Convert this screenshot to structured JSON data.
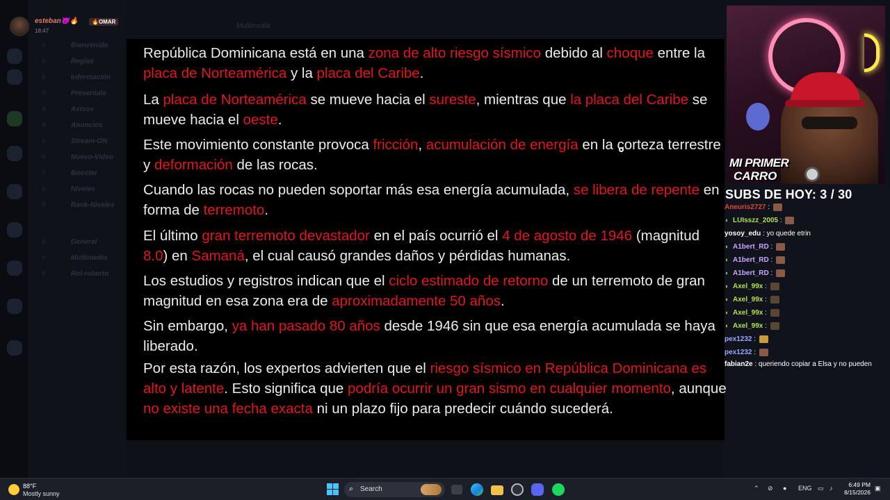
{
  "stream": {
    "streamer_name": "esteban👿🔥",
    "streamer_time": "18:47",
    "streamer_badge": "🔥OMAR",
    "bg_channel_title": "Multimedia",
    "bg_channels": [
      "Bienvenida",
      "Reglas",
      "Información",
      "Presentate",
      "Avisos",
      "Anuncios",
      "Stream-ON",
      "Nuevo-Video",
      "Booster",
      "Niveles",
      "Rank-Niveles",
      "General",
      "Multimedia",
      "Rol-roberto"
    ]
  },
  "article": {
    "paragraphs": [
      [
        {
          "t": "República Dominicana está en una ",
          "red": false
        },
        {
          "t": "zona de alto riesgo sísmico",
          "red": true
        },
        {
          "t": " debido al ",
          "red": false
        },
        {
          "t": "choque",
          "red": true
        },
        {
          "t": " entre la ",
          "red": false
        },
        {
          "t": "placa de Norteamérica",
          "red": true
        },
        {
          "t": " y la ",
          "red": false
        },
        {
          "t": "placa del Caribe",
          "red": true
        },
        {
          "t": ".",
          "red": false
        }
      ],
      [
        {
          "t": "La ",
          "red": false
        },
        {
          "t": "placa de Norteamérica",
          "red": true
        },
        {
          "t": " se mueve hacia el ",
          "red": false
        },
        {
          "t": "sureste",
          "red": true
        },
        {
          "t": ", mientras que ",
          "red": false
        },
        {
          "t": "la placa del Caribe",
          "red": true
        },
        {
          "t": " se mueve hacia el ",
          "red": false
        },
        {
          "t": "oeste",
          "red": true
        },
        {
          "t": ".",
          "red": false
        }
      ],
      [
        {
          "t": "Este movimiento constante provoca ",
          "red": false
        },
        {
          "t": "fricción",
          "red": true
        },
        {
          "t": ", ",
          "red": false
        },
        {
          "t": "acumulación de energía",
          "red": true
        },
        {
          "t": " en la corteza terrestre y ",
          "red": false
        },
        {
          "t": "deformación",
          "red": true
        },
        {
          "t": " de las rocas.",
          "red": false
        }
      ],
      [
        {
          "t": "Cuando las rocas no pueden soportar más esa energía acumulada, ",
          "red": false
        },
        {
          "t": "se libera de repente",
          "red": true
        },
        {
          "t": " en forma de ",
          "red": false
        },
        {
          "t": "terremoto",
          "red": true
        },
        {
          "t": ".",
          "red": false
        }
      ],
      [
        {
          "t": "El último ",
          "red": false
        },
        {
          "t": "gran terremoto devastador",
          "red": true
        },
        {
          "t": " en el país ocurrió el ",
          "red": false
        },
        {
          "t": "4 de agosto de 1946",
          "red": true
        },
        {
          "t": " (magnitud ",
          "red": false
        },
        {
          "t": "8.0",
          "red": true
        },
        {
          "t": ") en ",
          "red": false
        },
        {
          "t": "Samaná",
          "red": true
        },
        {
          "t": ", el cual causó grandes daños y pérdidas humanas.",
          "red": false
        }
      ],
      [
        {
          "t": "Los estudios y registros indican que el ",
          "red": false
        },
        {
          "t": "ciclo estimado de retorno",
          "red": true
        },
        {
          "t": " de un terremoto de gran magnitud en esa zona era de ",
          "red": false
        },
        {
          "t": "aproximadamente 50 años",
          "red": true
        },
        {
          "t": ".",
          "red": false
        }
      ],
      [
        {
          "t": "Sin embargo, ",
          "red": false
        },
        {
          "t": "ya han pasado 80 años",
          "red": true
        },
        {
          "t": " desde 1946 sin que esa energía acumulada se haya liberado.",
          "red": false
        }
      ],
      [
        {
          "t": "Por esta razón, los expertos advierten que el ",
          "red": false
        },
        {
          "t": "riesgo sísmico en República Dominicana es alto y latente",
          "red": true
        },
        {
          "t": ". Esto significa que ",
          "red": false
        },
        {
          "t": "podría ocurrir un gran sismo en cualquier momento",
          "red": true
        },
        {
          "t": ", aunque ",
          "red": false
        },
        {
          "t": "no existe una fecha exacta",
          "red": true
        },
        {
          "t": " ni un plazo fijo para predecir cuándo sucederá.",
          "red": false
        }
      ]
    ]
  },
  "webcam": {
    "overlay_line1": "MI PRIMER",
    "overlay_line2": "CARRO"
  },
  "subs": {
    "text": "SUBS DE HOY: 3 / 30"
  },
  "chat": {
    "messages": [
      {
        "user": "Aneuris2727",
        "color": "#e0453a",
        "msg": "",
        "emote": "normal",
        "icon": false
      },
      {
        "user": "LUIsszz_2005",
        "color": "#b4e04a",
        "msg": "",
        "emote": "normal",
        "icon": true
      },
      {
        "user": "yosoy_edu",
        "color": "#ffffff",
        "msg": "yo quede etrin",
        "emote": "",
        "icon": false
      },
      {
        "user": "A1bert_RD",
        "color": "#c9a8ff",
        "msg": "",
        "emote": "normal",
        "icon": true
      },
      {
        "user": "A1bert_RD",
        "color": "#c9a8ff",
        "msg": "",
        "emote": "normal",
        "icon": true
      },
      {
        "user": "A1bert_RD",
        "color": "#c9a8ff",
        "msg": "",
        "emote": "normal",
        "icon": true
      },
      {
        "user": "Axel_99x",
        "color": "#b4e04a",
        "msg": "",
        "emote": "dark",
        "icon": true
      },
      {
        "user": "Axel_99x",
        "color": "#b4e04a",
        "msg": "",
        "emote": "dark",
        "icon": true
      },
      {
        "user": "Axel_99x",
        "color": "#b4e04a",
        "msg": "",
        "emote": "dark",
        "icon": true
      },
      {
        "user": "Axel_99x",
        "color": "#b4e04a",
        "msg": "",
        "emote": "dark",
        "icon": true
      },
      {
        "user": "pex1232",
        "color": "#9aa8ff",
        "msg": "",
        "emote": "gold",
        "icon": false
      },
      {
        "user": "pex1232",
        "color": "#9aa8ff",
        "msg": "",
        "emote": "normal",
        "icon": false
      },
      {
        "user": "fabian2e",
        "color": "#ffffff",
        "msg": "queriendo copiar a Elsa y no pueden",
        "emote": "",
        "icon": false
      }
    ]
  },
  "taskbar": {
    "weather_temp": "88°F",
    "weather_desc": "Mostly sunny",
    "search_label": "Search",
    "lang": "ENG",
    "time": "6:49 PM",
    "date": "8/15/2026"
  },
  "colors": {
    "accent_red": "#e3161c",
    "text": "#ececec",
    "panel_bg": "#000000"
  }
}
